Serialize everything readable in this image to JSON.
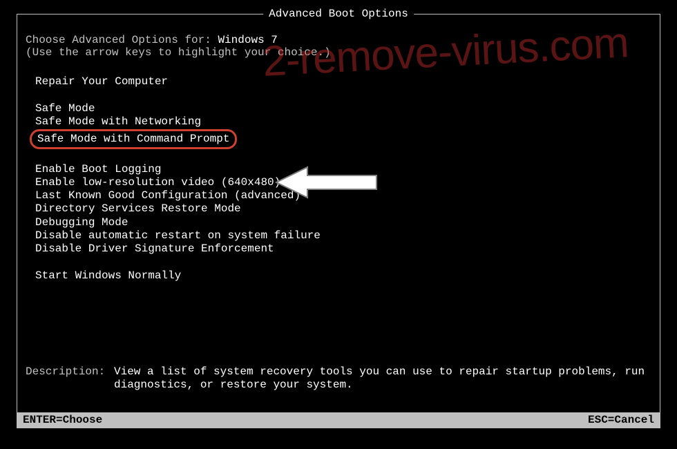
{
  "watermark": "2-remove-virus.com",
  "title": "Advanced Boot Options",
  "choose_prefix": "Choose Advanced Options for: ",
  "os_name": "Windows 7",
  "instruction": "(Use the arrow keys to highlight your choice.)",
  "menu": {
    "repair": "Repair Your Computer",
    "safe_mode": "Safe Mode",
    "safe_mode_networking": "Safe Mode with Networking",
    "safe_mode_cmd": "Safe Mode with Command Prompt",
    "boot_logging": "Enable Boot Logging",
    "low_res": "Enable low-resolution video (640x480)",
    "last_known": "Last Known Good Configuration (advanced)",
    "dsrm": "Directory Services Restore Mode",
    "debugging": "Debugging Mode",
    "disable_restart": "Disable automatic restart on system failure",
    "disable_driver_sig": "Disable Driver Signature Enforcement",
    "start_normally": "Start Windows Normally"
  },
  "description_label": "Description:",
  "description_text": "View a list of system recovery tools you can use to repair startup problems, run diagnostics, or restore your system.",
  "footer": {
    "enter": "ENTER=Choose",
    "esc": "ESC=Cancel"
  }
}
